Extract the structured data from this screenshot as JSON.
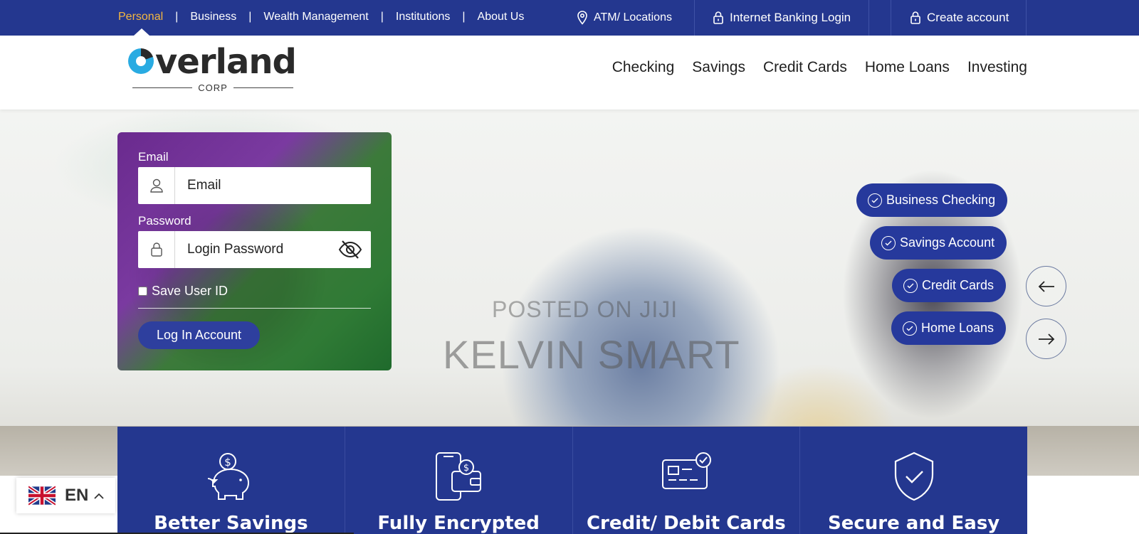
{
  "topbar": {
    "segments": [
      "Personal",
      "Business",
      "Wealth Management",
      "Institutions",
      "About Us"
    ],
    "separator": "|",
    "atm": "ATM/ Locations",
    "ib_login": "Internet Banking Login",
    "create_account": "Create account",
    "colors": {
      "bg": "#24378f",
      "active": "#f5b740"
    }
  },
  "logo": {
    "word": "verland",
    "sub": "CORP"
  },
  "mainnav": [
    "Checking",
    "Savings",
    "Credit Cards",
    "Home Loans",
    "Investing"
  ],
  "login": {
    "email_label": "Email",
    "email_placeholder": "Email",
    "password_label": "Password",
    "password_placeholder": "Login Password",
    "save_id": "Save User ID",
    "button": "Log In Account"
  },
  "watermark": {
    "line1": "POSTED ON JIJI",
    "line2": "KELVIN SMART"
  },
  "quick_links": [
    "Business Checking",
    "Savings Account",
    "Credit Cards",
    "Home Loans"
  ],
  "features": [
    "Better Savings",
    "Fully Encrypted",
    "Credit/ Debit Cards",
    "Secure and Easy"
  ],
  "language": {
    "code": "EN",
    "flag": "uk-flag-icon"
  }
}
